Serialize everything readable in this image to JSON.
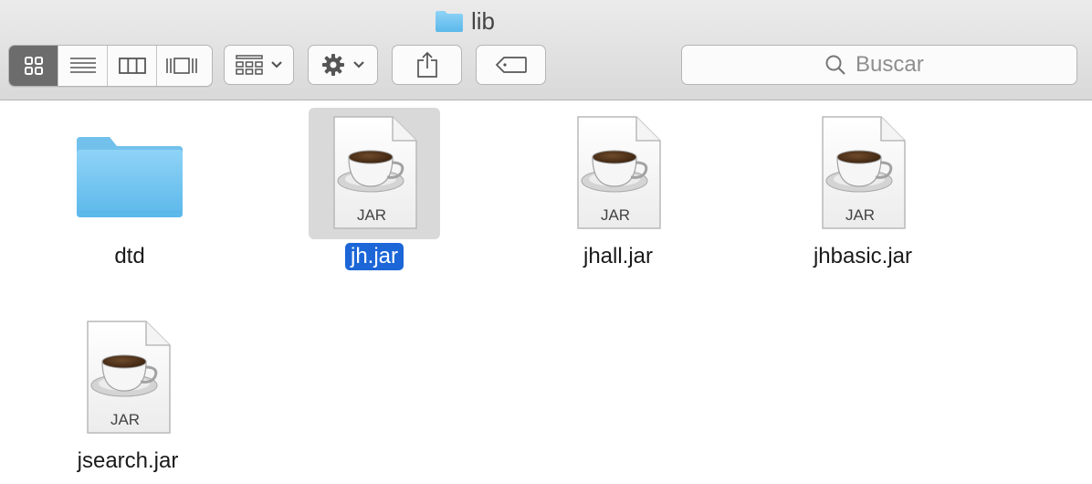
{
  "window": {
    "title": "lib"
  },
  "toolbar": {
    "view_modes": [
      "icon-view",
      "list-view",
      "column-view",
      "cover-flow-view"
    ],
    "active_view": "icon-view",
    "arrange_icon": "arrange-grid-icon",
    "action_icon": "gear-icon",
    "share_icon": "share-icon",
    "tags_icon": "tag-icon"
  },
  "search": {
    "placeholder": "Buscar",
    "value": ""
  },
  "files": [
    {
      "name": "dtd",
      "kind": "folder",
      "selected": false
    },
    {
      "name": "jh.jar",
      "kind": "jar",
      "selected": true
    },
    {
      "name": "jhall.jar",
      "kind": "jar",
      "selected": false
    },
    {
      "name": "jhbasic.jar",
      "kind": "jar",
      "selected": false
    },
    {
      "name": "jsearch.jar",
      "kind": "jar",
      "selected": false
    }
  ],
  "jar_badge": "JAR",
  "colors": {
    "selection": "#1c66d8",
    "folder": "#6cc2f0",
    "active_segment": "#6c6c6c"
  }
}
